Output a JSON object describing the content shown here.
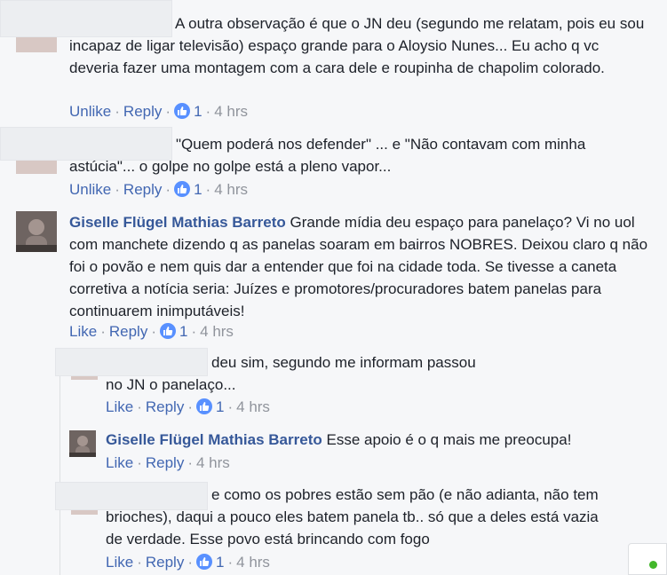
{
  "comments": [
    {
      "text": "A outra observação é que o JN deu (segundo me relatam, pois eu sou incapaz de ligar televisão) espaço grande para o Aloysio Nunes... Eu acho q vc deveria fazer uma montagem com a cara dele e roupinha de chapolim colorado.",
      "action": "Unlike",
      "reply": "Reply",
      "likes": "1",
      "time": "4 hrs"
    },
    {
      "text": "\"Quem poderá nos defender\" ... e \"Não contavam com minha astúcia\"... o golpe no golpe está a pleno vapor...",
      "action": "Unlike",
      "reply": "Reply",
      "likes": "1",
      "time": "4 hrs"
    },
    {
      "author": "Giselle Flügel Mathias Barreto",
      "text": "Grande mídia deu espaço para panelaço? Vi no uol com manchete dizendo q as panelas soaram em bairros NOBRES. Deixou claro q não foi o povão e nem quis dar a entender que foi na cidade toda. Se tivesse a caneta corretiva a notícia seria: Juízes e promotores/procuradores batem panelas para continuarem inimputáveis!",
      "action": "Like",
      "reply": "Reply",
      "likes": "1",
      "time": "4 hrs"
    }
  ],
  "replies": [
    {
      "text": "deu sim, segundo me informam passou no JN o panelaço...",
      "action": "Like",
      "reply": "Reply",
      "likes": "1",
      "time": "4 hrs"
    },
    {
      "author": "Giselle Flügel Mathias Barreto",
      "text": "Esse apoio é o q mais me preocupa!",
      "action": "Like",
      "reply": "Reply",
      "time": "4 hrs"
    },
    {
      "text": "e como os pobres estão sem pão (e não adianta, não tem brioches), daqui a pouco eles batem panela tb.. só que a deles está vazia de verdade. Esse povo está brincando com fogo",
      "action": "Like",
      "reply": "Reply",
      "likes": "1",
      "time": "4 hrs"
    }
  ],
  "colors": {
    "link": "#365899",
    "action": "#4267b2",
    "meta": "#90949c",
    "like_badge": "#5890ff",
    "online": "#42b72a"
  }
}
